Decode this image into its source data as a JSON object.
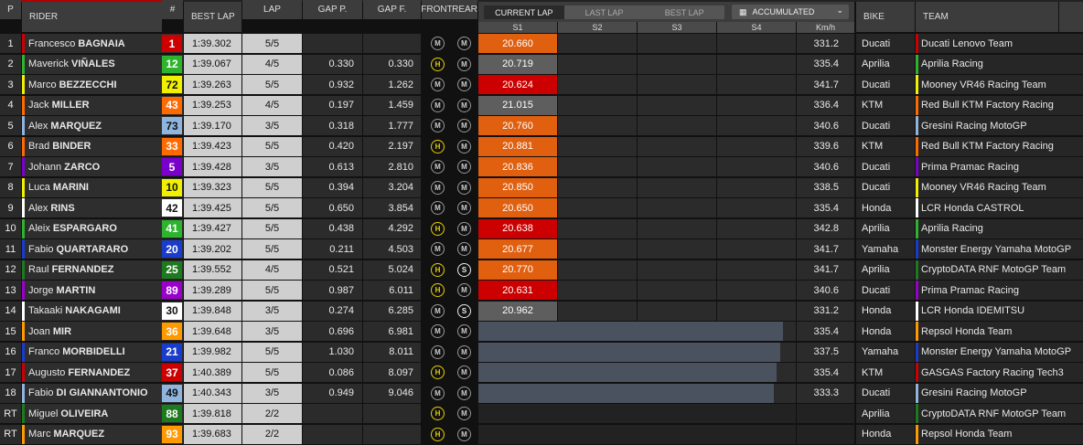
{
  "headers": {
    "pos": "P",
    "rider": "RIDER",
    "num": "#",
    "best_lap": "BEST LAP",
    "lap": "LAP",
    "gap_p": "GAP P.",
    "gap_f": "GAP F.",
    "front": "FRONT",
    "rear": "REAR",
    "bike": "BIKE",
    "team": "TEAM",
    "s1": "S1",
    "s2": "S2",
    "s3": "S3",
    "s4": "S4",
    "kmh": "Km/h"
  },
  "lap_tabs": {
    "current": "CURRENT LAP",
    "last": "LAST LAP",
    "best": "BEST LAP"
  },
  "mode_dropdown": {
    "selected": "ACCUMULATED"
  },
  "colors": {
    "sector_orange": "#e06010",
    "sector_red": "#cc0000",
    "sector_grey": "#5e5e5e",
    "tyre_hard": "#e8d000",
    "tyre_soft": "#ffffff",
    "tyre_medium": "#999999"
  },
  "rows": [
    {
      "pos": "1",
      "first": "Francesco",
      "last": "BAGNAIA",
      "num": "1",
      "num_bg": "#cc0000",
      "num_fg": "#ffffff",
      "best": "1:39.302",
      "lap": "5/5",
      "gap_p": "",
      "gap_f": "",
      "front": "M",
      "rear": "M",
      "s1": "20.660",
      "s1_color": "#e06010",
      "progress": 0.17,
      "kmh": "331.2",
      "bike": "Ducati",
      "team": "Ducati Lenovo Team",
      "team_color": "#cc0000"
    },
    {
      "pos": "2",
      "first": "Maverick",
      "last": "VIÑALES",
      "num": "12",
      "num_bg": "#2db32d",
      "num_fg": "#ffffff",
      "best": "1:39.067",
      "lap": "4/5",
      "gap_p": "0.330",
      "gap_f": "0.330",
      "front": "H",
      "rear": "M",
      "s1": "20.719",
      "s1_color": "#5e5e5e",
      "progress": 0.16,
      "kmh": "335.4",
      "bike": "Aprilia",
      "team": "Aprilia Racing",
      "team_color": "#2db32d"
    },
    {
      "pos": "3",
      "first": "Marco",
      "last": "BEZZECCHI",
      "num": "72",
      "num_bg": "#f0f000",
      "num_fg": "#111111",
      "best": "1:39.263",
      "lap": "5/5",
      "gap_p": "0.932",
      "gap_f": "1.262",
      "front": "M",
      "rear": "M",
      "s1": "20.624",
      "s1_color": "#cc0000",
      "progress": 0.15,
      "kmh": "341.7",
      "bike": "Ducati",
      "team": "Mooney VR46 Racing Team",
      "team_color": "#f0f000"
    },
    {
      "pos": "4",
      "first": "Jack",
      "last": "MILLER",
      "num": "43",
      "num_bg": "#ff6a00",
      "num_fg": "#ffffff",
      "best": "1:39.253",
      "lap": "4/5",
      "gap_p": "0.197",
      "gap_f": "1.459",
      "front": "M",
      "rear": "M",
      "s1": "21.015",
      "s1_color": "#5e5e5e",
      "progress": 0.14,
      "kmh": "336.4",
      "bike": "KTM",
      "team": "Red Bull KTM Factory Racing",
      "team_color": "#ff6a00"
    },
    {
      "pos": "5",
      "first": "Alex",
      "last": "MARQUEZ",
      "num": "73",
      "num_bg": "#8fb4de",
      "num_fg": "#111111",
      "best": "1:39.170",
      "lap": "3/5",
      "gap_p": "0.318",
      "gap_f": "1.777",
      "front": "M",
      "rear": "M",
      "s1": "20.760",
      "s1_color": "#e06010",
      "progress": 0.13,
      "kmh": "340.6",
      "bike": "Ducati",
      "team": "Gresini Racing MotoGP",
      "team_color": "#8fb4de"
    },
    {
      "pos": "6",
      "first": "Brad",
      "last": "BINDER",
      "num": "33",
      "num_bg": "#ff6a00",
      "num_fg": "#ffffff",
      "best": "1:39.423",
      "lap": "5/5",
      "gap_p": "0.420",
      "gap_f": "2.197",
      "front": "H",
      "rear": "M",
      "s1": "20.881",
      "s1_color": "#e06010",
      "progress": 0.12,
      "kmh": "339.6",
      "bike": "KTM",
      "team": "Red Bull KTM Factory Racing",
      "team_color": "#ff6a00"
    },
    {
      "pos": "7",
      "first": "Johann",
      "last": "ZARCO",
      "num": "5",
      "num_bg": "#7a00cc",
      "num_fg": "#ffffff",
      "best": "1:39.428",
      "lap": "3/5",
      "gap_p": "0.613",
      "gap_f": "2.810",
      "front": "M",
      "rear": "M",
      "s1": "20.836",
      "s1_color": "#e06010",
      "progress": 0.11,
      "kmh": "340.6",
      "bike": "Ducati",
      "team": "Prima Pramac Racing",
      "team_color": "#7a00cc"
    },
    {
      "pos": "8",
      "first": "Luca",
      "last": "MARINI",
      "num": "10",
      "num_bg": "#f0f000",
      "num_fg": "#111111",
      "best": "1:39.323",
      "lap": "5/5",
      "gap_p": "0.394",
      "gap_f": "3.204",
      "front": "M",
      "rear": "M",
      "s1": "20.850",
      "s1_color": "#e06010",
      "progress": 0.1,
      "kmh": "338.5",
      "bike": "Ducati",
      "team": "Mooney VR46 Racing Team",
      "team_color": "#f0f000"
    },
    {
      "pos": "9",
      "first": "Alex",
      "last": "RINS",
      "num": "42",
      "num_bg": "#ffffff",
      "num_fg": "#111111",
      "best": "1:39.425",
      "lap": "5/5",
      "gap_p": "0.650",
      "gap_f": "3.854",
      "front": "M",
      "rear": "M",
      "s1": "20.650",
      "s1_color": "#e06010",
      "progress": 0.09,
      "kmh": "335.4",
      "bike": "Honda",
      "team": "LCR Honda CASTROL",
      "team_color": "#ffffff"
    },
    {
      "pos": "10",
      "first": "Aleix",
      "last": "ESPARGARO",
      "num": "41",
      "num_bg": "#2db32d",
      "num_fg": "#ffffff",
      "best": "1:39.427",
      "lap": "5/5",
      "gap_p": "0.438",
      "gap_f": "4.292",
      "front": "H",
      "rear": "M",
      "s1": "20.638",
      "s1_color": "#cc0000",
      "progress": 0.08,
      "kmh": "342.8",
      "bike": "Aprilia",
      "team": "Aprilia Racing",
      "team_color": "#2db32d"
    },
    {
      "pos": "11",
      "first": "Fabio",
      "last": "QUARTARARO",
      "num": "20",
      "num_bg": "#1a3ccc",
      "num_fg": "#ffffff",
      "best": "1:39.202",
      "lap": "5/5",
      "gap_p": "0.211",
      "gap_f": "4.503",
      "front": "M",
      "rear": "M",
      "s1": "20.677",
      "s1_color": "#e06010",
      "progress": 0.07,
      "kmh": "341.7",
      "bike": "Yamaha",
      "team": "Monster Energy Yamaha MotoGP",
      "team_color": "#1a3ccc"
    },
    {
      "pos": "12",
      "first": "Raul",
      "last": "FERNANDEZ",
      "num": "25",
      "num_bg": "#1e7a1e",
      "num_fg": "#ffffff",
      "best": "1:39.552",
      "lap": "4/5",
      "gap_p": "0.521",
      "gap_f": "5.024",
      "front": "H",
      "rear": "S",
      "s1": "20.770",
      "s1_color": "#e06010",
      "progress": 0.07,
      "kmh": "341.7",
      "bike": "Aprilia",
      "team": "CryptoDATA RNF MotoGP Team",
      "team_color": "#1e7a1e"
    },
    {
      "pos": "13",
      "first": "Jorge",
      "last": "MARTIN",
      "num": "89",
      "num_bg": "#9a00cc",
      "num_fg": "#ffffff",
      "best": "1:39.289",
      "lap": "5/5",
      "gap_p": "0.987",
      "gap_f": "6.011",
      "front": "H",
      "rear": "M",
      "s1": "20.631",
      "s1_color": "#cc0000",
      "progress": 0.06,
      "kmh": "340.6",
      "bike": "Ducati",
      "team": "Prima Pramac Racing",
      "team_color": "#9a00cc"
    },
    {
      "pos": "14",
      "first": "Takaaki",
      "last": "NAKAGAMI",
      "num": "30",
      "num_bg": "#ffffff",
      "num_fg": "#111111",
      "best": "1:39.848",
      "lap": "3/5",
      "gap_p": "0.274",
      "gap_f": "6.285",
      "front": "M",
      "rear": "S",
      "s1": "20.962",
      "s1_color": "#5e5e5e",
      "progress": 0.05,
      "kmh": "331.2",
      "bike": "Honda",
      "team": "LCR Honda IDEMITSU",
      "team_color": "#ffffff"
    },
    {
      "pos": "15",
      "first": "Joan",
      "last": "MIR",
      "num": "36",
      "num_bg": "#ff9900",
      "num_fg": "#ffffff",
      "best": "1:39.648",
      "lap": "3/5",
      "gap_p": "0.696",
      "gap_f": "6.981",
      "front": "M",
      "rear": "M",
      "s1": "",
      "s1_color": "",
      "progress": 0.96,
      "kmh": "335.4",
      "bike": "Honda",
      "team": "Repsol Honda Team",
      "team_color": "#ff9900"
    },
    {
      "pos": "16",
      "first": "Franco",
      "last": "MORBIDELLI",
      "num": "21",
      "num_bg": "#1a3ccc",
      "num_fg": "#ffffff",
      "best": "1:39.982",
      "lap": "5/5",
      "gap_p": "1.030",
      "gap_f": "8.011",
      "front": "M",
      "rear": "M",
      "s1": "",
      "s1_color": "",
      "progress": 0.95,
      "kmh": "337.5",
      "bike": "Yamaha",
      "team": "Monster Energy Yamaha MotoGP",
      "team_color": "#1a3ccc"
    },
    {
      "pos": "17",
      "first": "Augusto",
      "last": "FERNANDEZ",
      "num": "37",
      "num_bg": "#cc0000",
      "num_fg": "#ffffff",
      "best": "1:40.389",
      "lap": "5/5",
      "gap_p": "0.086",
      "gap_f": "8.097",
      "front": "H",
      "rear": "M",
      "s1": "",
      "s1_color": "",
      "progress": 0.94,
      "kmh": "335.4",
      "bike": "KTM",
      "team": "GASGAS Factory Racing Tech3",
      "team_color": "#cc0000"
    },
    {
      "pos": "18",
      "first": "Fabio",
      "last": "DI GIANNANTONIO",
      "num": "49",
      "num_bg": "#8fb4de",
      "num_fg": "#111111",
      "best": "1:40.343",
      "lap": "3/5",
      "gap_p": "0.949",
      "gap_f": "9.046",
      "front": "M",
      "rear": "M",
      "s1": "",
      "s1_color": "",
      "progress": 0.93,
      "kmh": "333.3",
      "bike": "Ducati",
      "team": "Gresini Racing MotoGP",
      "team_color": "#8fb4de"
    },
    {
      "pos": "RT",
      "first": "Miguel",
      "last": "OLIVEIRA",
      "num": "88",
      "num_bg": "#1e7a1e",
      "num_fg": "#ffffff",
      "best": "1:39.818",
      "lap": "2/2",
      "gap_p": "",
      "gap_f": "",
      "front": "H",
      "rear": "M",
      "s1": "",
      "s1_color": "",
      "progress": 0,
      "kmh": "",
      "bike": "Aprilia",
      "team": "CryptoDATA RNF MotoGP Team",
      "team_color": "#1e7a1e"
    },
    {
      "pos": "RT",
      "first": "Marc",
      "last": "MARQUEZ",
      "num": "93",
      "num_bg": "#ff9900",
      "num_fg": "#ffffff",
      "best": "1:39.683",
      "lap": "2/2",
      "gap_p": "",
      "gap_f": "",
      "front": "H",
      "rear": "M",
      "s1": "",
      "s1_color": "",
      "progress": 0,
      "kmh": "",
      "bike": "Honda",
      "team": "Repsol Honda Team",
      "team_color": "#ff9900"
    }
  ]
}
